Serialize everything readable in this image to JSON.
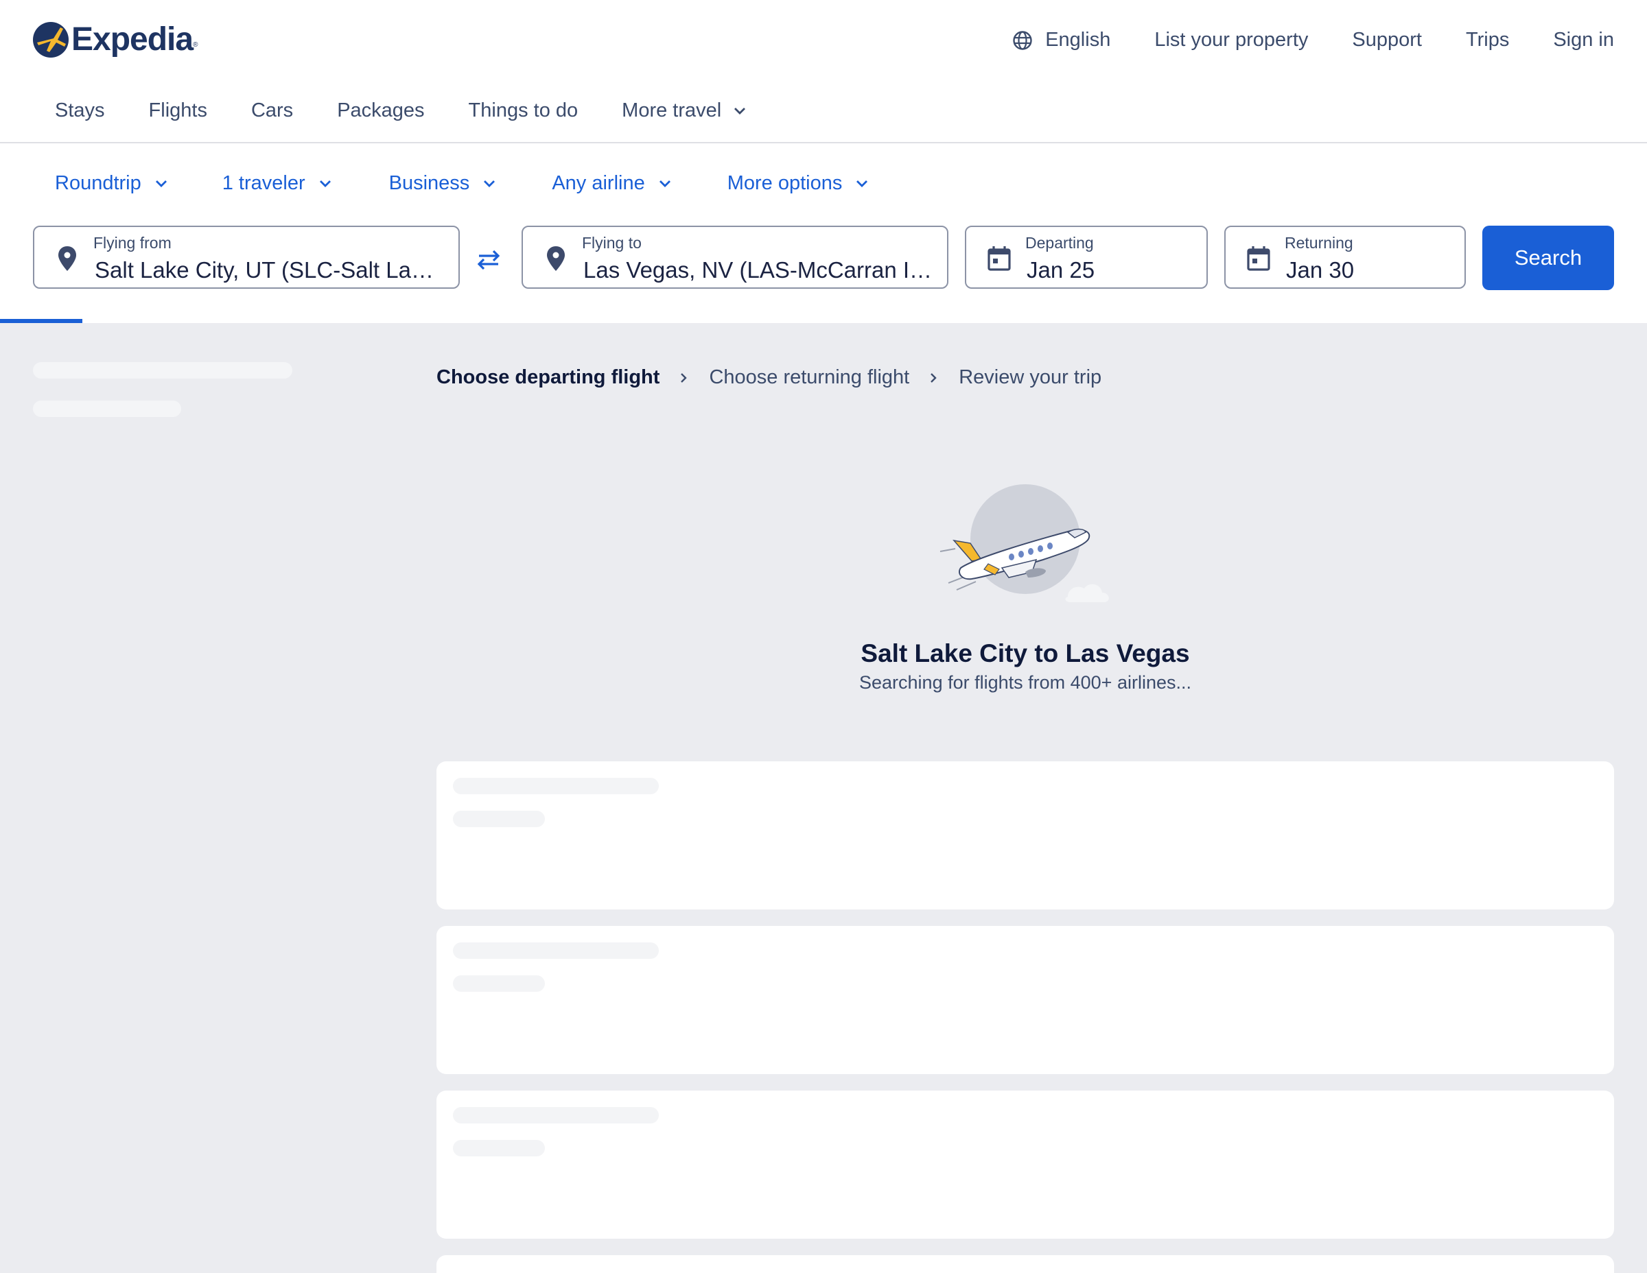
{
  "brand": {
    "name": "Expedia",
    "registered": "®"
  },
  "util_nav": {
    "language": "English",
    "list_property": "List your property",
    "support": "Support",
    "trips": "Trips",
    "sign_in": "Sign in"
  },
  "lob_nav": {
    "stays": "Stays",
    "flights": "Flights",
    "cars": "Cars",
    "packages": "Packages",
    "things_to_do": "Things to do",
    "more_travel": "More travel"
  },
  "search_options": {
    "trip_type": "Roundtrip",
    "travelers": "1 traveler",
    "cabin_class": "Business",
    "airline": "Any airline",
    "more_options": "More options"
  },
  "search_form": {
    "origin_label": "Flying from",
    "origin_value": "Salt Lake City, UT (SLC-Salt Lake City Intl.)",
    "destination_label": "Flying to",
    "destination_value": "Las Vegas, NV (LAS-McCarran Intl.)",
    "departing_label": "Departing",
    "departing_value": "Jan 25",
    "returning_label": "Returning",
    "returning_value": "Jan 30",
    "search_button": "Search"
  },
  "breadcrumb": {
    "step1": "Choose departing flight",
    "step2": "Choose returning flight",
    "step3": "Review your trip"
  },
  "loading": {
    "title": "Salt Lake City to Las Vegas",
    "subtitle": "Searching for flights from 400+ airlines..."
  },
  "colors": {
    "brand_navy": "#1e3462",
    "accent_blue": "#1a5fd6",
    "page_bg": "#ebecf0",
    "plane_yellow": "#f5b82e"
  }
}
